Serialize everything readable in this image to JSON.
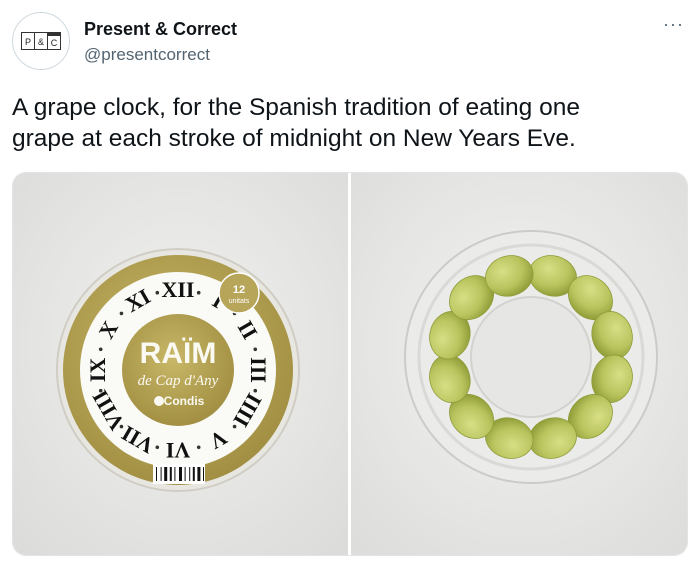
{
  "author": {
    "name": "Present & Correct",
    "handle": "@presentcorrect",
    "avatar_letters": [
      "P",
      "&",
      "C"
    ]
  },
  "more_icon": "more-horizontal-icon",
  "more_label": "···",
  "tweet": {
    "text": "A grape clock, for the Spanish tradition of eating one\ngrape at each stroke of midnight on New Years Eve."
  },
  "media": {
    "left_photo": {
      "brand": "RAÏM",
      "subtitle": "de Cap d'Any",
      "maker": "Condis",
      "badge_number": "12",
      "badge_unit": "unitats",
      "numerals": [
        "XII",
        "I",
        "II",
        "III",
        "IIII",
        "V",
        "VI",
        "VII",
        "VIII",
        "IX",
        "X",
        "XI"
      ]
    },
    "right_photo": {
      "grape_count": 12
    }
  },
  "colors": {
    "gold": "#b7a55a",
    "gold_dark": "#9d8c45",
    "grape": "#b9c45e",
    "grape_shade": "#94a13b",
    "backdrop": "#e9e9e9"
  }
}
